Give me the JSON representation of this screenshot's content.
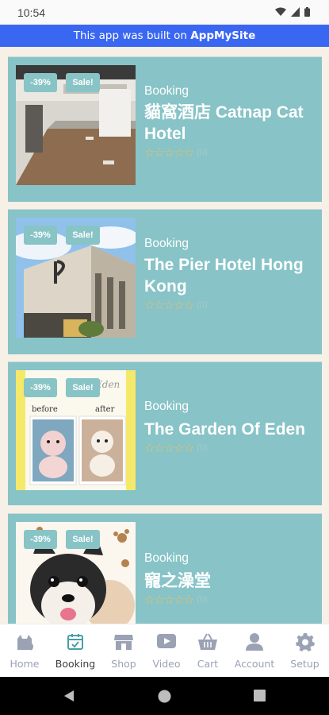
{
  "status_bar": {
    "time": "10:54"
  },
  "banner": {
    "prefix": "This app was built on ",
    "brand": "AppMySite"
  },
  "products": [
    {
      "discount": "-39%",
      "sale": "Sale!",
      "category": "Booking",
      "title": "貓窩酒店 Catnap Cat Hotel",
      "stars": "☆☆☆☆☆",
      "reviews": "(0)"
    },
    {
      "discount": "-39%",
      "sale": "Sale!",
      "category": "Booking",
      "title": "The Pier Hotel Hong Kong",
      "stars": "☆☆☆☆☆",
      "reviews": "(0)"
    },
    {
      "discount": "-39%",
      "sale": "Sale!",
      "category": "Booking",
      "title": "The Garden Of Eden",
      "stars": "☆☆☆☆☆",
      "reviews": "(0)"
    },
    {
      "discount": "-39%",
      "sale": "Sale!",
      "category": "Booking",
      "title": "寵之澡堂",
      "stars": "☆☆☆☆☆",
      "reviews": "(0)"
    }
  ],
  "tabs": [
    {
      "label": "Home",
      "icon": "cat-icon"
    },
    {
      "label": "Booking",
      "icon": "calendar-check-icon",
      "active": true
    },
    {
      "label": "Shop",
      "icon": "storefront-icon"
    },
    {
      "label": "Video",
      "icon": "play-icon"
    },
    {
      "label": "Cart",
      "icon": "basket-icon"
    },
    {
      "label": "Account",
      "icon": "user-icon"
    },
    {
      "label": "Setup",
      "icon": "gear-icon"
    }
  ],
  "colors": {
    "card": "#87c3c7",
    "banner": "#3a67f2",
    "tab_active": "#4a9fa6",
    "tab_inactive": "#9aa2b3",
    "star": "#e7c36a"
  }
}
